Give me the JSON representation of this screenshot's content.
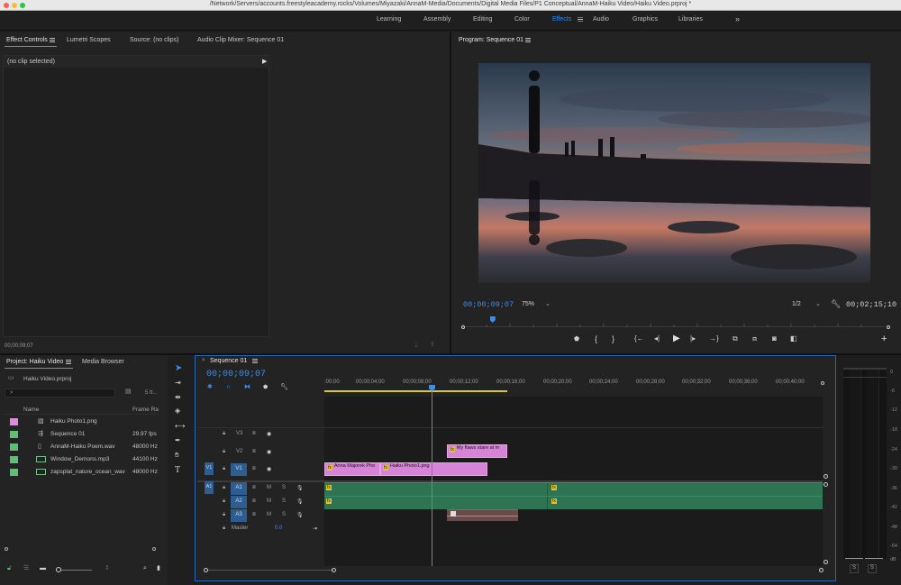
{
  "window": {
    "title": "/Network/Servers/accounts.freestyleacademy.rocks/Volumes/Miyazaki/AnnaM-Media/Documents/Digital Media Files/P1 Conceptual/AnnaM-Haiku Video/Haiku Video.prproj *"
  },
  "workspaces": {
    "items": [
      "Learning",
      "Assembly",
      "Editing",
      "Color",
      "Effects",
      "Audio",
      "Graphics",
      "Libraries"
    ],
    "active": "Effects",
    "more": "»"
  },
  "source_panel": {
    "tabs": [
      "Effect Controls",
      "Lumetri Scopes",
      "Source: (no clips)",
      "Audio Clip Mixer: Sequence 01"
    ],
    "no_clip": "(no clip selected)",
    "timecode": "00;00;09;07"
  },
  "program_monitor": {
    "title": "Program: Sequence 01",
    "timecode": "00;00;09;07",
    "zoom": "75%",
    "resolution": "1/2",
    "duration": "00;02;15;10",
    "playhead_fraction": 0.07
  },
  "project_panel": {
    "tabs": [
      "Project: Haiku Video",
      "Media Browser"
    ],
    "file": "Haiku Video.prproj",
    "item_count": "5 It...",
    "columns": [
      "Name",
      "Frame Ra"
    ],
    "items": [
      {
        "name": "Haiku Photo1.png",
        "rate": "",
        "color": "#e08ae0",
        "icon": "image-icon"
      },
      {
        "name": "Sequence 01",
        "rate": "29.97 fps",
        "color": "#5fbe75",
        "icon": "sequence-icon"
      },
      {
        "name": "AnnaM-Haiku Poem.wav",
        "rate": "48000 Hz",
        "color": "#5fbe75",
        "icon": "audio-file-icon"
      },
      {
        "name": "Window_Demons.mp3",
        "rate": "44100 Hz",
        "color": "#5fbe75",
        "icon": "audio-clip-icon"
      },
      {
        "name": "zapsplat_nature_ocean_wav",
        "rate": "48000 Hz",
        "color": "#5fbe75",
        "icon": "audio-clip-icon"
      }
    ]
  },
  "timeline": {
    "tab": "Sequence 01",
    "timecode": "00;00;09;07",
    "ruler": [
      ":00;00",
      "00;00;04;00",
      "00;00;08;00",
      "00;00;12;00",
      "00;00;16;00",
      "00;00;20;00",
      "00;00;24;00",
      "00;00;28;00",
      "00;00;32;00",
      "00;00;36;00",
      "00;00;40;00"
    ],
    "tracks": {
      "v3": "V3",
      "v2": "V2",
      "v1": "V1",
      "v1_source": "V1",
      "a1": "A1",
      "a1_source": "A1",
      "a2": "A2",
      "a3": "A3",
      "master": "Master",
      "master_value": "0.0",
      "m": "M",
      "s": "S"
    },
    "clips": {
      "v2_clip": "My flaws stare at m",
      "v1_clip_a": "Anna Majorek Pho",
      "v1_clip_b": "Haiku Photo1.png",
      "fx": "fx"
    }
  },
  "audio_meter": {
    "labels": [
      "0",
      "-6",
      "-12",
      "-18",
      "-24",
      "-30",
      "-36",
      "-42",
      "-48",
      "-54",
      "dB"
    ],
    "solo": "S"
  },
  "tools": [
    "selection-tool",
    "track-select-tool",
    "ripple-edit-tool",
    "razor-tool",
    "slip-tool",
    "pen-tool",
    "hand-tool",
    "type-tool"
  ],
  "colors": {
    "accent": "#2d8ceb",
    "video_clip": "#d684d6",
    "audio_clip": "#2e7453",
    "playhead": "#3b8ef0"
  }
}
